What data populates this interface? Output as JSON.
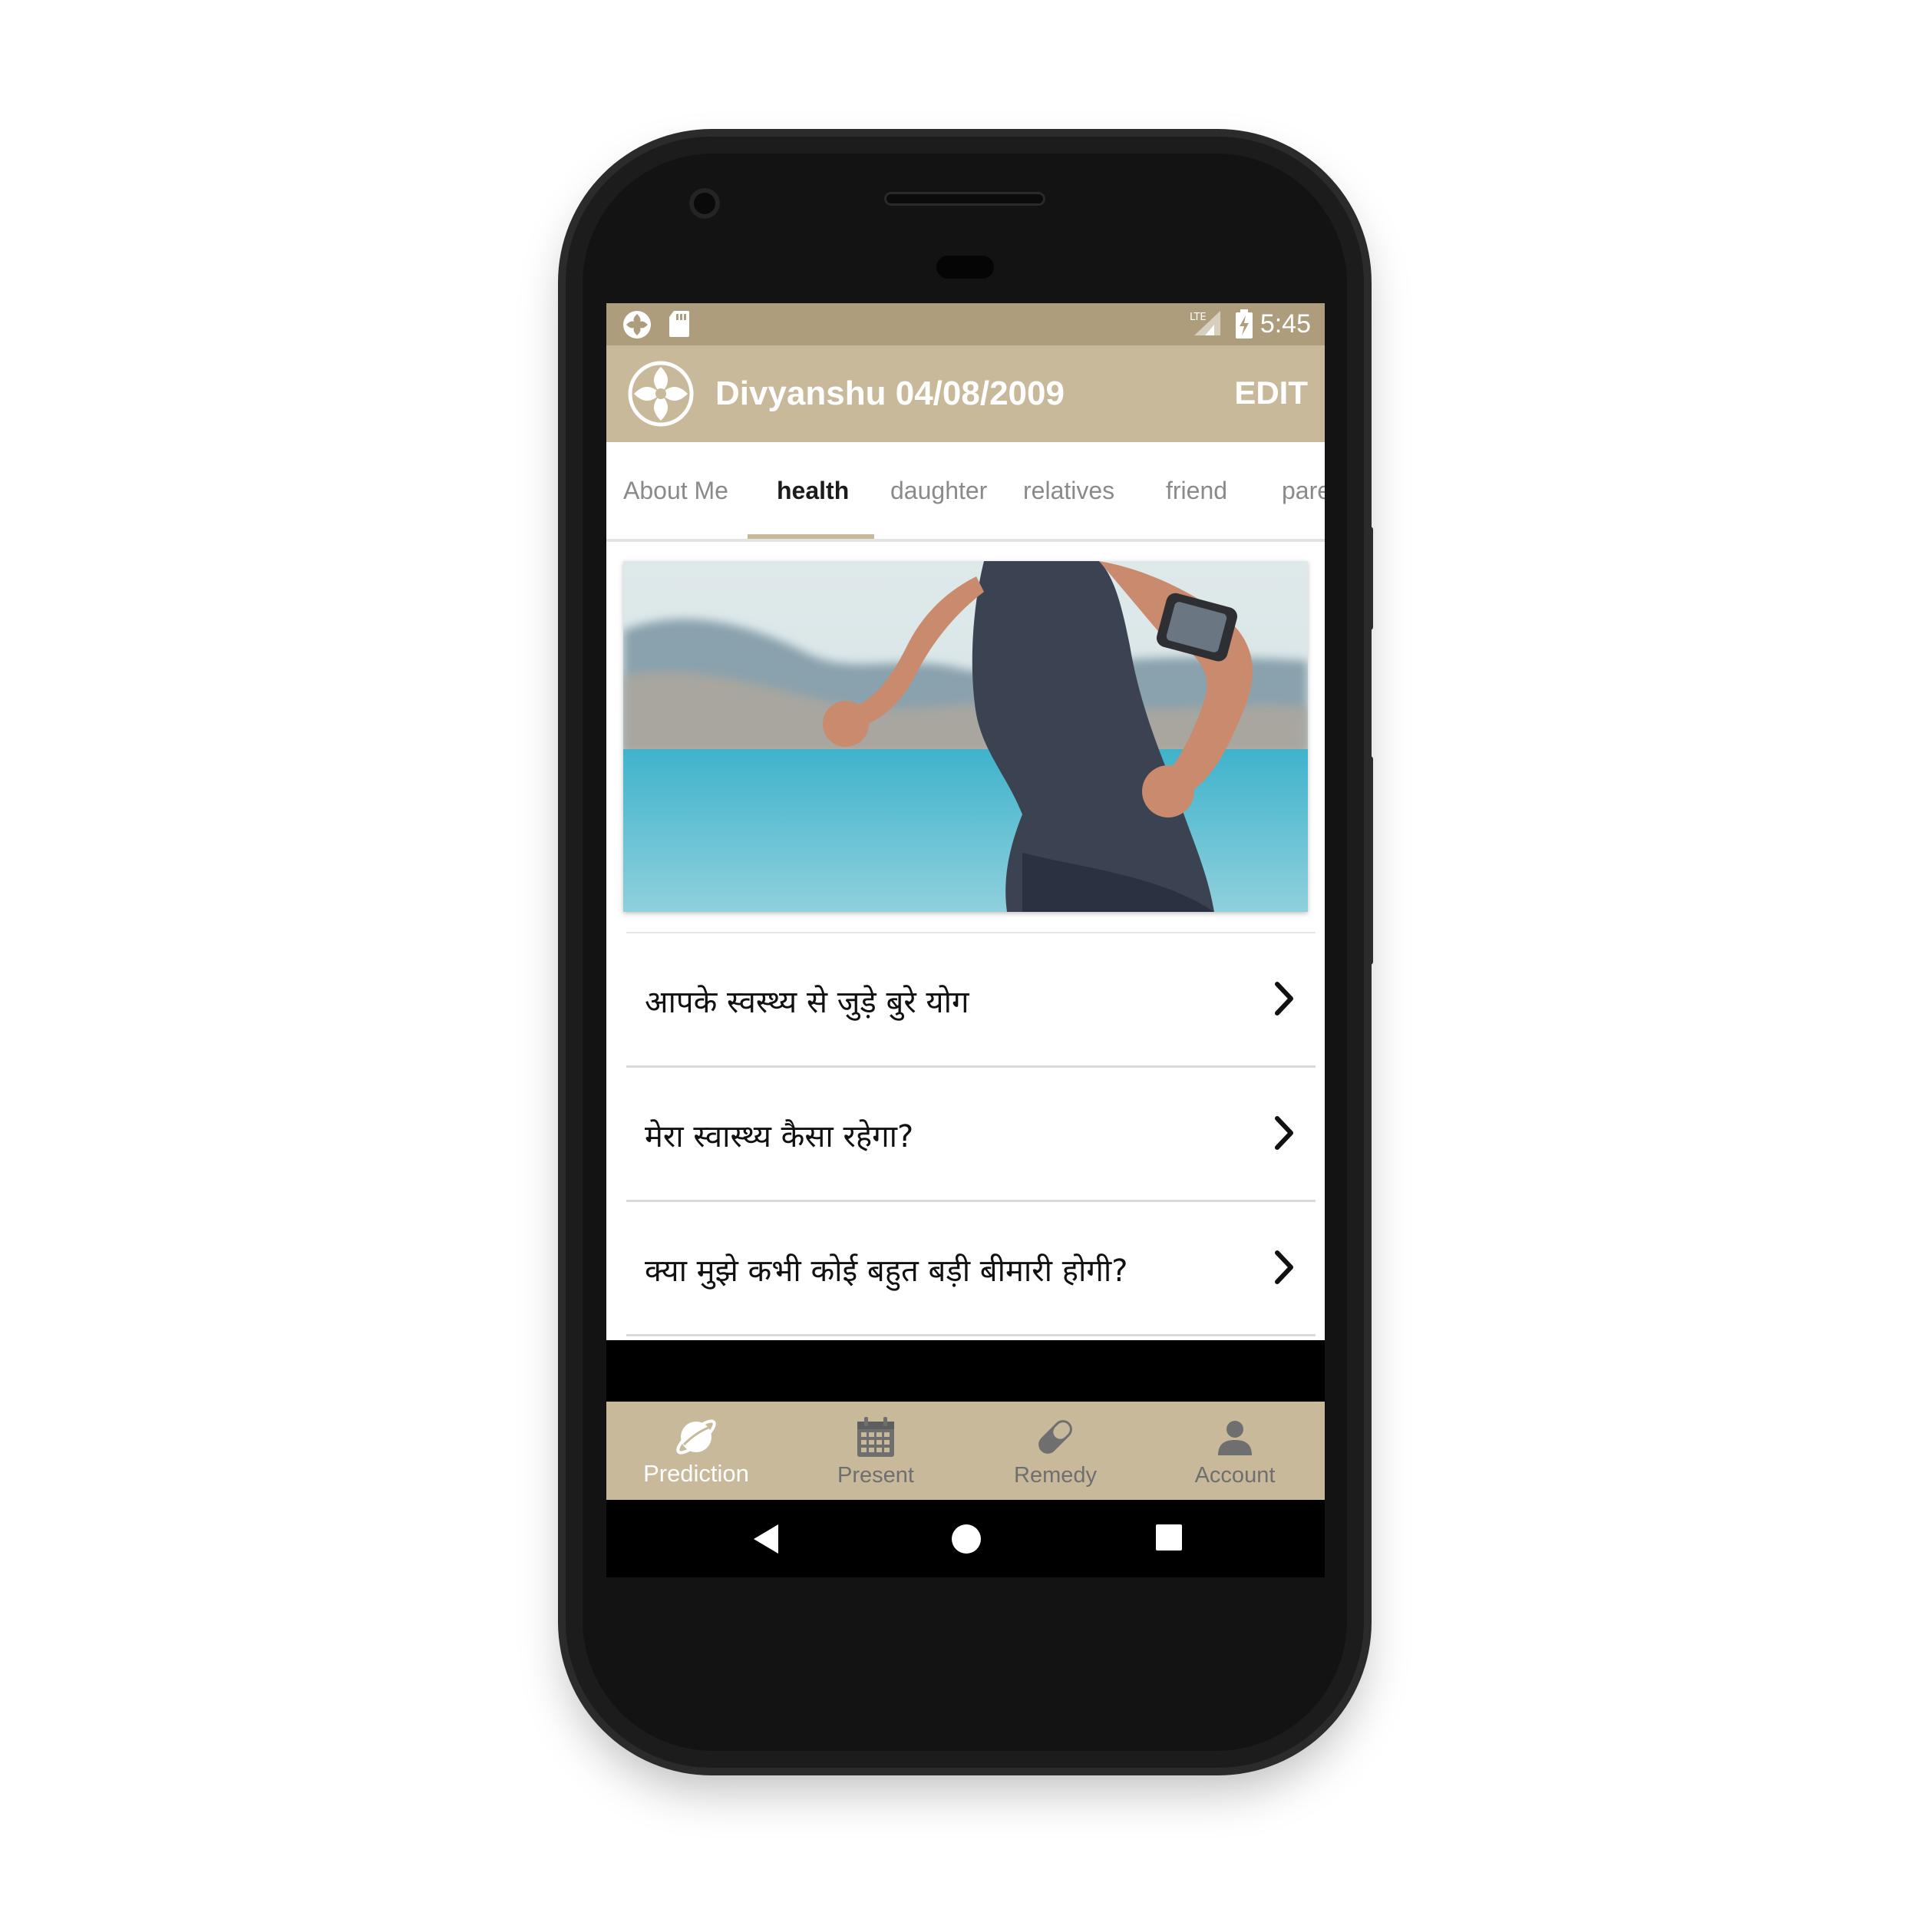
{
  "status_bar": {
    "time": "5:45",
    "icons": [
      "app-notification-icon",
      "sd-card-icon",
      "lte-signal-icon",
      "battery-charging-icon"
    ]
  },
  "app_bar": {
    "title": "Divyanshu 04/08/2009",
    "edit_label": "EDIT",
    "logo": "lotus-logo-icon"
  },
  "tabs": [
    {
      "label": "About Me",
      "active": false
    },
    {
      "label": "health",
      "active": true
    },
    {
      "label": "daughter",
      "active": false
    },
    {
      "label": "relatives",
      "active": false
    },
    {
      "label": "friend",
      "active": false
    },
    {
      "label": "pare",
      "active": false
    }
  ],
  "hero_image": {
    "description_icon": "runner-photo"
  },
  "questions": [
    {
      "label": "आपके स्वस्थ्य से जुड़े बुरे योग"
    },
    {
      "label": "मेरा स्वास्थ्य कैसा रहेगा?"
    },
    {
      "label": "क्या मुझे कभी कोई बहुत बड़ी बीमारी होगी?"
    }
  ],
  "bottom_nav": [
    {
      "label": "Prediction",
      "icon": "planet-icon",
      "active": true
    },
    {
      "label": "Present",
      "icon": "calendar-icon",
      "active": false
    },
    {
      "label": "Remedy",
      "icon": "pill-icon",
      "active": false
    },
    {
      "label": "Account",
      "icon": "person-icon",
      "active": false
    }
  ],
  "colors": {
    "status_bar": "#ae9d7c",
    "app_bar": "#c8b99b",
    "tab_indicator": "#c8b99b",
    "bottom_nav": "#c8b99b"
  }
}
